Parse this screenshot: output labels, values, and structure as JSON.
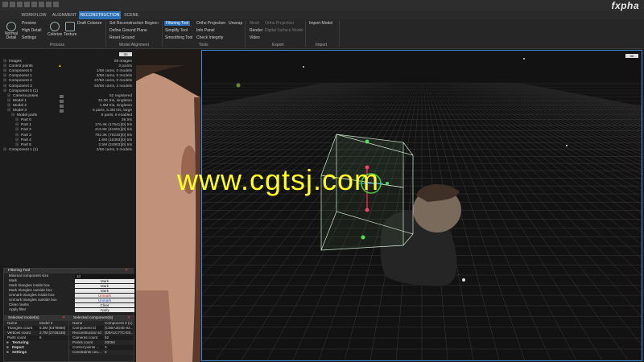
{
  "titlebar": {
    "logo": "fxpha",
    "window_buttons": [
      "—",
      "□",
      "✕"
    ]
  },
  "tabs": [
    {
      "label": "WORKFLOW",
      "active": false
    },
    {
      "label": "ALIGNMENT",
      "active": false
    },
    {
      "label": "RECONSTRUCTION",
      "active": true
    },
    {
      "label": "SCENE",
      "active": false
    }
  ],
  "ribbon": {
    "normal_detail": "Normal Detail",
    "preview": "Preview",
    "high_detail": "High Detail",
    "settings": "Settings",
    "draft_colorize": "Draft Colorize",
    "colorize": "Colorize",
    "texture": "Texture",
    "process_group": "Process",
    "set_recon_region": "Set Reconstruction Region",
    "define_ground_plane": "Define Ground Plane",
    "reset_ground": "Reset Ground",
    "model_alignment_group": "Model Alignment",
    "filtering_tool": "Filtering Tool",
    "simplify_tool": "Simplify Tool",
    "smoothing_tool": "Smoothing Tool",
    "ortho_projection": "Ortho Projection",
    "unwrap": "Unwrap",
    "info_panel": "Info Panel",
    "check_integrity": "Check Integrity",
    "tools_group": "Tools",
    "mesh": "Mesh",
    "render": "Render",
    "video": "Video",
    "ortho_projection_export": "Ortho Projection",
    "digital_surface_model": "Digital Surface Model",
    "export_group": "Export",
    "import_model": "Import Model",
    "import_group": "Import"
  },
  "tree": {
    "header_badge": "3D",
    "rows": [
      {
        "label": "Images",
        "indent": 0,
        "value": "58 images",
        "warn": false
      },
      {
        "label": "Control points",
        "indent": 0,
        "value": "3 points",
        "warn": true
      },
      {
        "label": "Component 0",
        "indent": 0,
        "value": "1/58 cams, 0 models",
        "warn": false
      },
      {
        "label": "Component 1",
        "indent": 0,
        "value": "2/58 cams, 0 models",
        "warn": false
      },
      {
        "label": "Component 2",
        "indent": 0,
        "value": "47/58 cams, 0 models",
        "warn": false
      },
      {
        "label": "Component 3",
        "indent": 0,
        "value": "53/58 cams, 3 models",
        "warn": false
      },
      {
        "label": "Component 5 (1)",
        "indent": 0,
        "value": "",
        "warn": false
      },
      {
        "label": "Camera poses",
        "indent": 1,
        "value": "52 registered",
        "warn": false
      },
      {
        "label": "Model 1",
        "indent": 1,
        "value": "32.3K tris, singleton",
        "warn": false
      },
      {
        "label": "Model 2",
        "indent": 1,
        "value": "1.5M tris, singleton",
        "warn": false
      },
      {
        "label": "Model 3",
        "indent": 1,
        "value": "6 parts, 5.3M tris, large",
        "warn": false
      },
      {
        "label": "Model parts",
        "indent": 2,
        "value": "6 parts, 6 enabled",
        "warn": false
      },
      {
        "label": "Part 0",
        "indent": 3,
        "value": "36 tris",
        "warn": false
      },
      {
        "label": "Part 1",
        "indent": 3,
        "value": "176.4K (17641)[0] tris",
        "warn": false
      },
      {
        "label": "Part 2",
        "indent": 3,
        "value": "416.9K (41691)[0] tris",
        "warn": false
      },
      {
        "label": "Part 3",
        "indent": 3,
        "value": "792.3K (79230)[0] tris",
        "warn": false
      },
      {
        "label": "Part 4",
        "indent": 3,
        "value": "1.6M (16393)[0] tris",
        "warn": false
      },
      {
        "label": "Part 5",
        "indent": 3,
        "value": "2.5M (24903)[0] tris",
        "warn": false
      },
      {
        "label": "Component 1 (1)",
        "indent": 0,
        "value": "2/58 cams, 0 models",
        "warn": false
      }
    ]
  },
  "filtering_tool": {
    "title": "Filtering Tool",
    "rows": [
      {
        "key": "Minimal component size",
        "kind": "box",
        "value": "10"
      },
      {
        "key": "Mark",
        "kind": "btn",
        "value": "Mark",
        "tone": ""
      },
      {
        "key": "Mark triangles inside box",
        "kind": "btn",
        "value": "Mark",
        "tone": ""
      },
      {
        "key": "Mark triangles outside box",
        "kind": "btn",
        "value": "Mark",
        "tone": ""
      },
      {
        "key": "Unmark triangles inside box",
        "kind": "btn",
        "value": "Unmark",
        "tone": "red"
      },
      {
        "key": "Unmark triangles outside box",
        "kind": "btn",
        "value": "Unmark",
        "tone": "blue"
      },
      {
        "key": "Clear marks",
        "kind": "btn",
        "value": "Clear",
        "tone": ""
      },
      {
        "key": "Apply filter",
        "kind": "btn",
        "value": "Apply",
        "tone": ""
      }
    ]
  },
  "selected_models": {
    "title": "Selected model(s)",
    "rows": [
      {
        "key": "Name",
        "value": "Model 3"
      },
      {
        "key": "Triangles count",
        "value": "5.3M (5479856)"
      },
      {
        "key": "Vertices count",
        "value": "2.7M (2748248)"
      },
      {
        "key": "Parts count",
        "value": "6"
      }
    ],
    "sections": [
      "Texturing",
      "Report",
      "Settings"
    ]
  },
  "selected_components": {
    "title": "Selected component(s)",
    "rows": [
      {
        "key": "Name",
        "value": "Component 3 (1)"
      },
      {
        "key": "Component Id",
        "value": "{C0BA3D4E-82..."
      },
      {
        "key": "Reconstruction Id",
        "value": "{D9A1C77C-E8..."
      },
      {
        "key": "Cameras count",
        "value": "52"
      },
      {
        "key": "Points count",
        "value": "20058"
      },
      {
        "key": "Control points ...",
        "value": "3"
      },
      {
        "key": "Constraints cou...",
        "value": "0"
      }
    ]
  },
  "viewport": {
    "badge": "3D"
  },
  "watermark": "www.cgtsj.com"
}
